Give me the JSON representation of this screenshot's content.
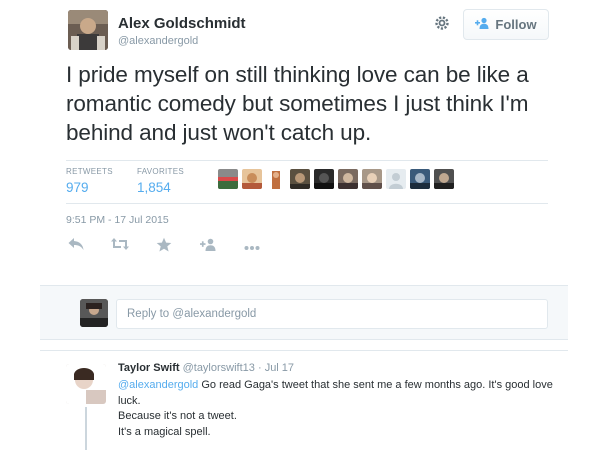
{
  "tweet": {
    "author_name": "Alex Goldschmidt",
    "author_handle": "@alexandergold",
    "follow_label": "Follow",
    "text": "I pride myself on still thinking love can be like a romantic comedy but sometimes I just think I'm behind and just won't catch up.",
    "retweets_label": "RETWEETS",
    "retweets_count": "979",
    "favorites_label": "FAVORITES",
    "favorites_count": "1,854",
    "timestamp": "9:51 PM - 17 Jul 2015",
    "icons": {
      "settings": "gear-icon",
      "follow": "add-user-icon",
      "reply": "reply-icon",
      "retweet": "retweet-icon",
      "favorite": "star-icon",
      "follow_action": "add-user-icon",
      "more": "more-icon"
    }
  },
  "reply_box": {
    "placeholder_prefix": "Reply to ",
    "placeholder_mention": "@alexandergold"
  },
  "reply_tweet": {
    "author_name": "Taylor Swift",
    "author_handle": "@taylorswift13",
    "separator": " · ",
    "date": "Jul 17",
    "mention": "@alexandergold",
    "line1_rest": " Go read Gaga's tweet that she sent me a few months ago. It's good love luck.",
    "line2": "Because it's not a tweet.",
    "line3": "It's a magical spell."
  },
  "colors": {
    "link_blue": "#55acee",
    "muted_gray": "#8899a6",
    "text_dark": "#292f33",
    "border": "#e1e8ed"
  }
}
